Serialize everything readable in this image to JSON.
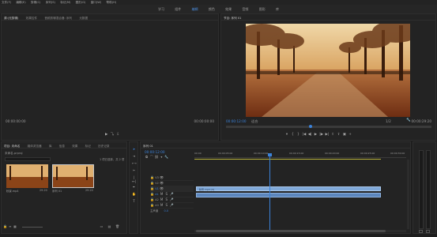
{
  "menubar": {
    "items": [
      "文件(F)",
      "编辑(E)",
      "剪辑(C)",
      "序列(S)",
      "标记(M)",
      "图形(G)",
      "窗口(W)",
      "帮助(H)"
    ]
  },
  "workspaces": {
    "items": [
      "学习",
      "组件",
      "编辑",
      "颜色",
      "效果",
      "音频",
      "图形",
      "库"
    ],
    "active_index": 2
  },
  "source_panel": {
    "tabs": [
      "源:(无剪辑)",
      "效果控件",
      "音频剪辑混合器: 序列",
      "元数据"
    ],
    "tc_left": "00:00:00:00",
    "tc_right": "00:00:00:00"
  },
  "program_panel": {
    "title": "节目: 序列 01",
    "tc_current": "00:00:12:00",
    "fit": "适合",
    "ratio": "1/2",
    "tc_duration": "00:00:29:20"
  },
  "project_panel": {
    "tabs": [
      "项目: 未命名",
      "媒体浏览器",
      "库",
      "信息",
      "效果",
      "标记",
      "历史记录"
    ],
    "file": "未命名.prproj",
    "count": "1 项已选择，共 2 项",
    "items": [
      {
        "name": "秋景.mp4",
        "duration": "29:20"
      },
      {
        "name": "序列 01",
        "duration": "29:20"
      }
    ]
  },
  "timeline": {
    "tab": "序列 01",
    "tc": "00:00:12:00",
    "ruler": [
      "00:00",
      "00:00:05:00",
      "00:00:10:00",
      "00:00:15:00",
      "00:00:20:00",
      "00:00:25:00",
      "00:00:30:00"
    ],
    "video_tracks": [
      "V3",
      "V2",
      "V1"
    ],
    "audio_tracks": [
      "A1",
      "A2",
      "A3"
    ],
    "master": "主声道",
    "master_value": "0.0",
    "clip_label": "秋景.mp4 [V]"
  }
}
